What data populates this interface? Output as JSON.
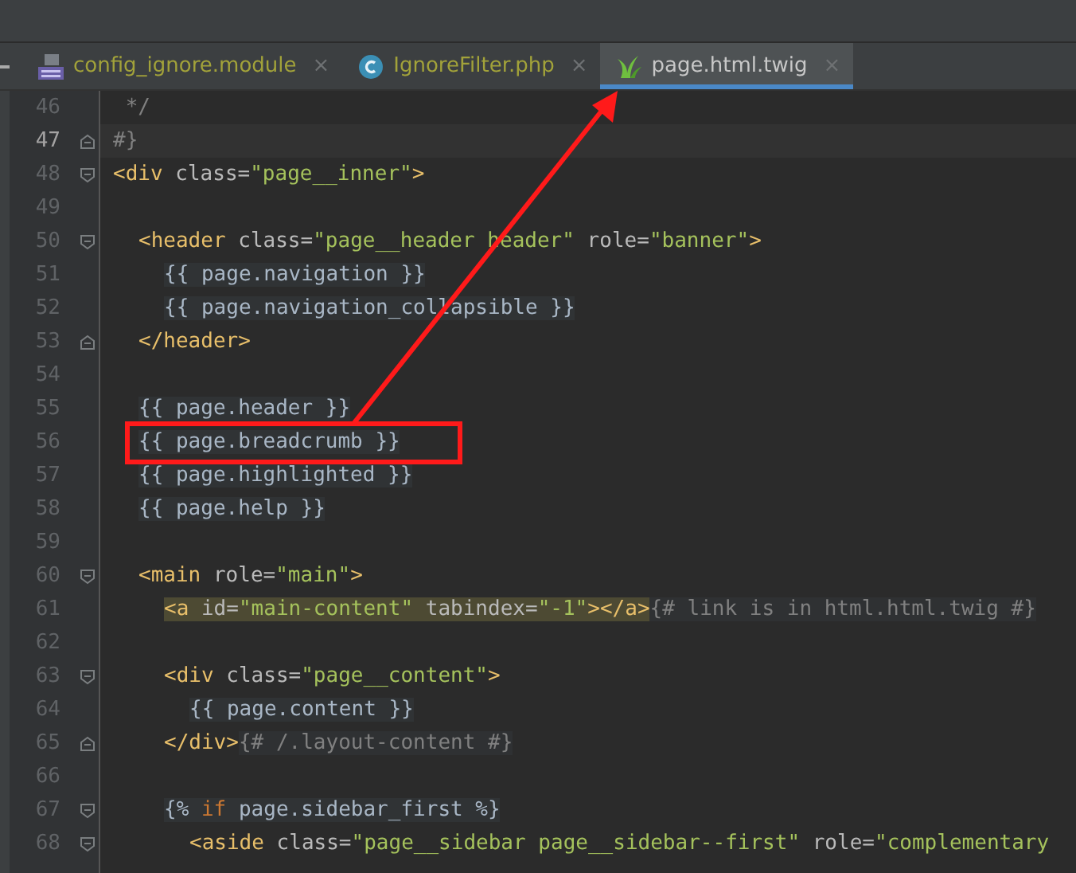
{
  "tabs": [
    {
      "label": "config_ignore.module",
      "kind": "php",
      "selected": false,
      "color": "#a2a23a"
    },
    {
      "label": "IgnoreFilter.php",
      "kind": "class",
      "selected": false,
      "color": "#a2a23a"
    },
    {
      "label": "page.html.twig",
      "kind": "twig",
      "selected": true,
      "color": "#c8c8c8"
    }
  ],
  "close_glyph": "×",
  "lines": [
    {
      "number": "46",
      "kind": "plain",
      "current": false,
      "tokens": [
        {
          "kind": "comment",
          "text": " */"
        }
      ]
    },
    {
      "number": "47",
      "kind": "closing",
      "current": true,
      "tokens": [
        {
          "kind": "comment",
          "text": "#}"
        }
      ]
    },
    {
      "number": "48",
      "kind": "opening",
      "current": false,
      "tokens": [
        {
          "kind": "tag",
          "text": "<div"
        },
        {
          "kind": "attr",
          "text": " class="
        },
        {
          "kind": "string",
          "text": "\"page__inner\""
        },
        {
          "kind": "tag",
          "text": ">"
        }
      ],
      "children": [
        {
          "number": "49",
          "kind": "blank",
          "current": false
        },
        {
          "number": "50",
          "kind": "opening",
          "current": false,
          "tokens": [
            {
              "kind": "tag",
              "text": "<header"
            },
            {
              "kind": "attr",
              "text": " class="
            },
            {
              "kind": "string",
              "text": "\"page__header header\""
            },
            {
              "kind": "attr",
              "text": " role="
            },
            {
              "kind": "string",
              "text": "\"banner\""
            },
            {
              "kind": "tag",
              "text": ">"
            }
          ],
          "children": [
            {
              "number": "51",
              "kind": "plain",
              "current": false,
              "tokens": [
                {
                  "kind": "twig",
                  "text": "{{ page.navigation }}"
                }
              ]
            },
            {
              "number": "52",
              "kind": "plain",
              "current": false,
              "tokens": [
                {
                  "kind": "twig",
                  "text": "{{ page.navigation_collapsible }}"
                }
              ]
            }
          ]
        },
        {
          "number": "53",
          "kind": "closing",
          "current": false,
          "tokens": [
            {
              "kind": "tag",
              "text": "</header>"
            }
          ]
        },
        {
          "number": "54",
          "kind": "blank",
          "current": false
        },
        {
          "number": "55",
          "kind": "plain",
          "current": false,
          "tokens": [
            {
              "kind": "twig",
              "text": "{{ page.header }}"
            }
          ]
        },
        {
          "number": "56",
          "kind": "plain",
          "current": false,
          "tokens": [
            {
              "kind": "twig",
              "text": "{{ page.breadcrumb }}"
            }
          ]
        },
        {
          "number": "57",
          "kind": "plain",
          "current": false,
          "tokens": [
            {
              "kind": "twig",
              "text": "{{ page.highlighted }}"
            }
          ]
        },
        {
          "number": "58",
          "kind": "plain",
          "current": false,
          "tokens": [
            {
              "kind": "twig",
              "text": "{{ page.help }}"
            }
          ]
        },
        {
          "number": "59",
          "kind": "blank",
          "current": false
        },
        {
          "number": "60",
          "kind": "opening",
          "current": false,
          "tokens": [
            {
              "kind": "tag",
              "text": "<main"
            },
            {
              "kind": "attr",
              "text": " role="
            },
            {
              "kind": "string",
              "text": "\"main\""
            },
            {
              "kind": "tag",
              "text": ">"
            }
          ],
          "children": [
            {
              "number": "61",
              "kind": "plain",
              "current": false,
              "tag_highlighted": true,
              "tokens": [
                {
                  "kind": "tag",
                  "text": "<a"
                },
                {
                  "kind": "attr",
                  "text": " id="
                },
                {
                  "kind": "string",
                  "text": "\"main-content\""
                },
                {
                  "kind": "attr",
                  "text": " tabindex="
                },
                {
                  "kind": "string",
                  "text": "\"-1\""
                },
                {
                  "kind": "tag",
                  "text": "></a>"
                },
                {
                  "kind": "comment",
                  "text": "{# link is in html.html.twig #}"
                }
              ]
            },
            {
              "number": "62",
              "kind": "blank",
              "current": false
            },
            {
              "number": "63",
              "kind": "opening",
              "current": false,
              "tokens": [
                {
                  "kind": "tag",
                  "text": "<div"
                },
                {
                  "kind": "attr",
                  "text": " class="
                },
                {
                  "kind": "string",
                  "text": "\"page__content\""
                },
                {
                  "kind": "tag",
                  "text": ">"
                }
              ],
              "children": [
                {
                  "number": "64",
                  "kind": "plain",
                  "current": false,
                  "tokens": [
                    {
                      "kind": "twig",
                      "text": "{{ page.content }}"
                    }
                  ]
                }
              ]
            },
            {
              "number": "65",
              "kind": "closing",
              "current": false,
              "tokens": [
                {
                  "kind": "tag",
                  "text": "</div>"
                },
                {
                  "kind": "comment",
                  "text": "{# /.layout-content #}"
                }
              ]
            },
            {
              "number": "66",
              "kind": "blank",
              "current": false
            },
            {
              "number": "67",
              "kind": "opening",
              "current": false,
              "tokens": [
                {
                  "kind": "twig",
                  "text": "{% "
                },
                {
                  "kind": "keyword",
                  "text": "if"
                },
                {
                  "kind": "twig",
                  "text": " page.sidebar_first %}"
                }
              ],
              "children": [
                {
                  "number": "68",
                  "kind": "opening",
                  "current": false,
                  "tokens": [
                    {
                      "kind": "tag",
                      "text": "<aside"
                    },
                    {
                      "kind": "attr",
                      "text": " class="
                    },
                    {
                      "kind": "string",
                      "text": "\"page__sidebar page__sidebar--first\""
                    },
                    {
                      "kind": "attr",
                      "text": " role="
                    },
                    {
                      "kind": "string",
                      "text": "\"complementary"
                    }
                  ]
                }
              ]
            }
          ]
        }
      ]
    }
  ]
}
